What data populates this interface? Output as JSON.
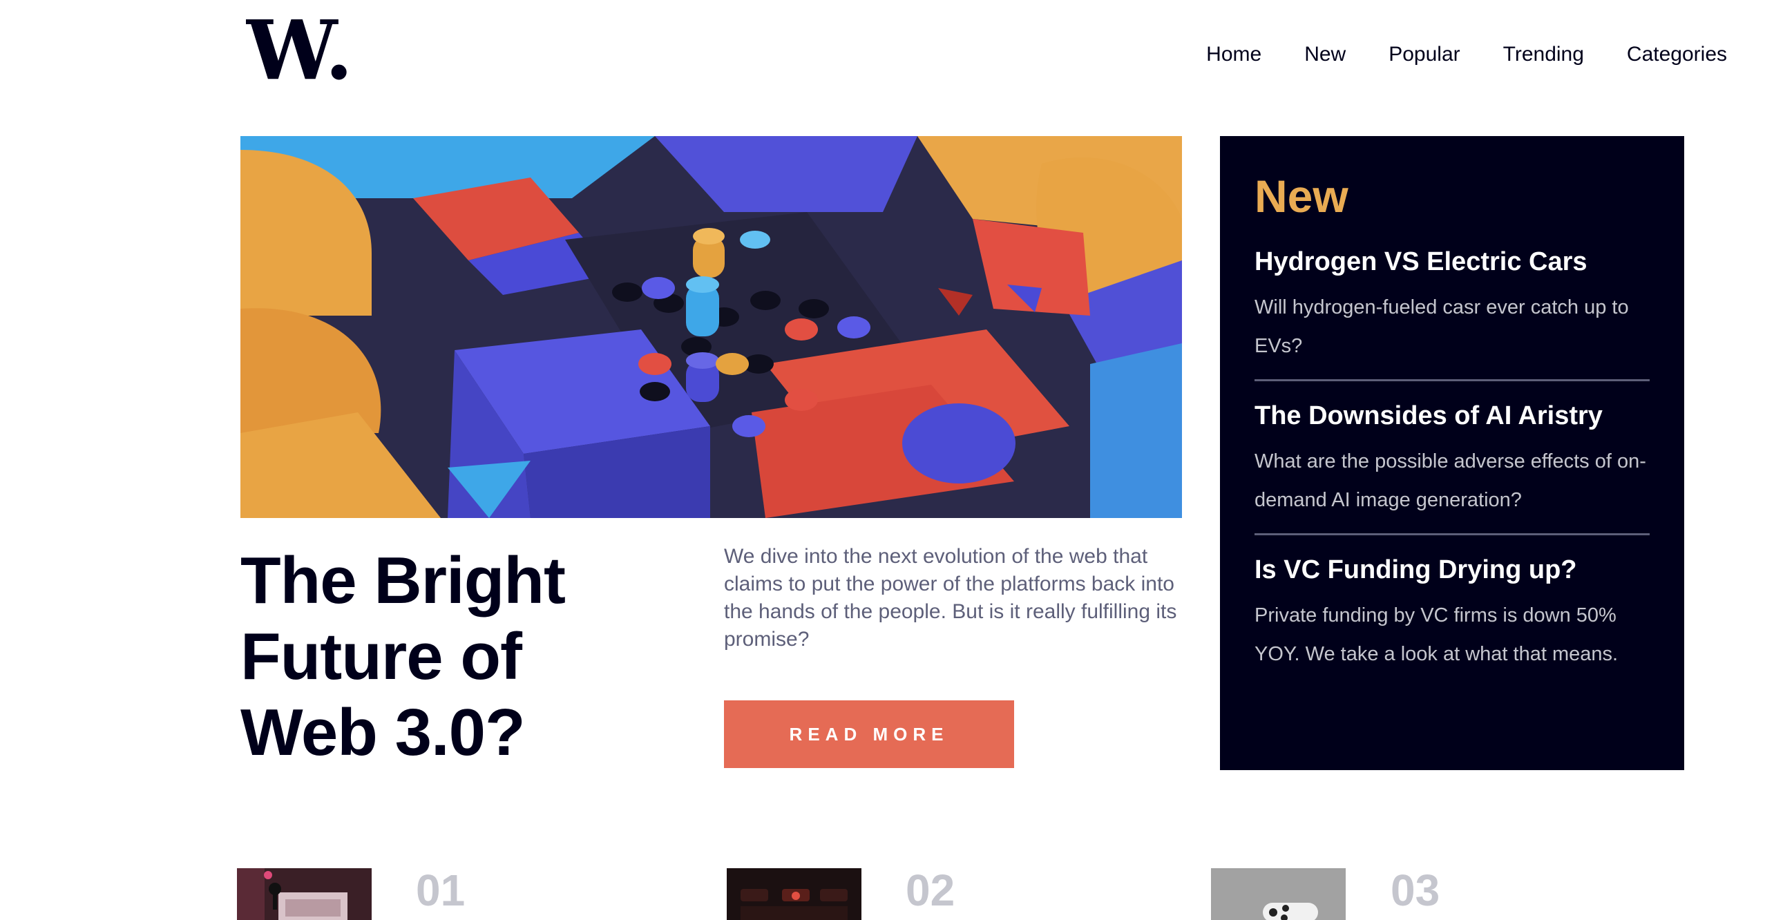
{
  "brand": {
    "logo_text": "W."
  },
  "nav": {
    "items": [
      "Home",
      "New",
      "Popular",
      "Trending",
      "Categories"
    ]
  },
  "hero": {
    "title_lines": [
      "The Bright",
      "Future of",
      "Web 3.0?"
    ],
    "description": "We dive into the next evolution of the web that claims to put the power of the platforms back into the hands of the people. But is it really fulfilling its promise?",
    "cta_label": "READ  MORE"
  },
  "new_panel": {
    "heading": "New",
    "items": [
      {
        "title": "Hydrogen VS Electric Cars",
        "summary": "Will hydrogen-fueled casr ever catch up to EVs?"
      },
      {
        "title": "The Downsides of AI Aristry",
        "summary": "What are the possible adverse effects of on-demand AI image generation?"
      },
      {
        "title": "Is VC Funding Drying up?",
        "summary": "Private funding by VC firms is down 50% YOY. We take a look at what that means."
      }
    ]
  },
  "numbered_articles": [
    {
      "number": "01"
    },
    {
      "number": "02"
    },
    {
      "number": "03"
    }
  ],
  "colors": {
    "dark_navy": "#00001a",
    "accent_orange": "#e9ab53",
    "button_red": "#e56b55",
    "muted_text": "#5d5f79",
    "grey_numbers": "#c5c6ce"
  }
}
